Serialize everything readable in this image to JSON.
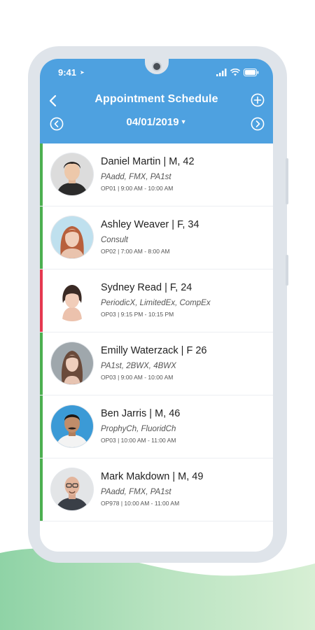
{
  "status_bar": {
    "time": "9:41"
  },
  "header": {
    "title": "Appointment Schedule",
    "date": "04/01/2019",
    "bg_color": "#4ea1e0"
  },
  "appointments": [
    {
      "name_line": "Daniel Martin | M, 42",
      "codes": "PAadd, FMX, PA1st",
      "slot": "OP01 | 9:00 AM - 10:00 AM",
      "status_color": "#4caf50"
    },
    {
      "name_line": "Ashley Weaver | F, 34",
      "codes": "Consult",
      "slot": "OP02 | 7:00 AM - 8:00 AM",
      "status_color": "#4caf50"
    },
    {
      "name_line": "Sydney Read | F, 24",
      "codes": "PeriodicX, LimitedEx, CompEx",
      "slot": "OP03 | 9:15 PM - 10:15 PM",
      "status_color": "#e53950"
    },
    {
      "name_line": "Emilly Waterzack | F 26",
      "codes": "PA1st, 2BWX, 4BWX",
      "slot": "OP03 | 9:00 AM - 10:00 AM",
      "status_color": "#4caf50"
    },
    {
      "name_line": "Ben Jarris | M, 46",
      "codes": "ProphyCh, FluoridCh",
      "slot": "OP03 | 10:00 AM - 11:00 AM",
      "status_color": "#4caf50"
    },
    {
      "name_line": "Mark Makdown | M, 49",
      "codes": "PAadd, FMX, PA1st",
      "slot": "OP978 | 10:00 AM - 11:00 AM",
      "status_color": "#4caf50"
    }
  ]
}
